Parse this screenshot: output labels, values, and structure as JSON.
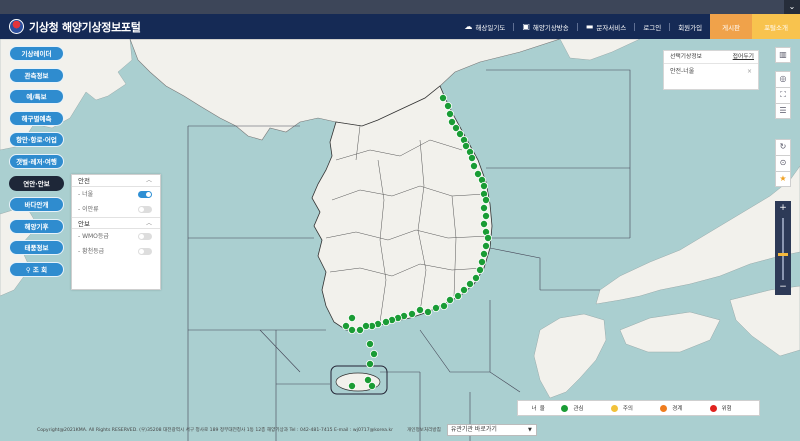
{
  "header": {
    "logo_text": "기상청 해양기상정보포털",
    "nav": [
      {
        "label": "해상일기도",
        "icon": "weather-chart-icon"
      },
      {
        "label": "해양기상방송",
        "icon": "radio-icon"
      },
      {
        "label": "문자서비스",
        "icon": "message-icon"
      },
      {
        "label": "로그인"
      },
      {
        "label": "회원가입"
      },
      {
        "label": "게시판"
      },
      {
        "label": "포털소개"
      }
    ]
  },
  "menu": [
    {
      "label": "기상레이더",
      "active": false
    },
    {
      "label": "관측정보",
      "active": false
    },
    {
      "label": "예/특보",
      "active": false
    },
    {
      "label": "해구별예측",
      "active": false
    },
    {
      "label": "항만·항로·어업",
      "active": false
    },
    {
      "label": "갯벌·레저·여행",
      "active": false
    },
    {
      "label": "연안·안보",
      "active": true
    },
    {
      "label": "바다안개",
      "active": false
    },
    {
      "label": "해양기후",
      "active": false
    },
    {
      "label": "태풍정보",
      "active": false
    },
    {
      "label": "조 회",
      "active": false
    }
  ],
  "panel": {
    "section1": "안전",
    "rows1": [
      {
        "label": "- 너울",
        "on": true
      },
      {
        "label": "- 이안류",
        "on": false
      }
    ],
    "section2": "안보",
    "rows2": [
      {
        "label": "- WMO등급",
        "on": false
      },
      {
        "label": "- 황천등급",
        "on": false
      }
    ]
  },
  "selected_info": {
    "title": "선택기상정보",
    "fold": "접어두기",
    "item": "안전-너울",
    "remove": "×"
  },
  "tools_top": [
    "building-icon",
    "compass-icon",
    "fullscreen-icon",
    "layers-icon"
  ],
  "tools_mid": [
    "refresh-icon",
    "location-icon",
    "star-icon"
  ],
  "zoom": {
    "plus": "+",
    "minus": "−"
  },
  "legend": {
    "title": "너울",
    "items": [
      {
        "label": "관심",
        "color": "#1a9c35"
      },
      {
        "label": "주의",
        "color": "#f2c23a"
      },
      {
        "label": "경계",
        "color": "#ef7d1f"
      },
      {
        "label": "위험",
        "color": "#e0231f"
      }
    ]
  },
  "footer": {
    "copyright": "Copyright@2021KMA. All Rights RESERVED.   (우)35208 대전광역시 서구 청사로 189 정부대전청사 1동 12층 해양기상과 Tel : 042-481-7415 E-mail : wj0717@korea.kr",
    "privacy": "개인정보처리방침",
    "related_sites": "유관기관 바로가기"
  },
  "markers": {
    "level": "관심",
    "color": "#1a9c35",
    "count": 52
  }
}
